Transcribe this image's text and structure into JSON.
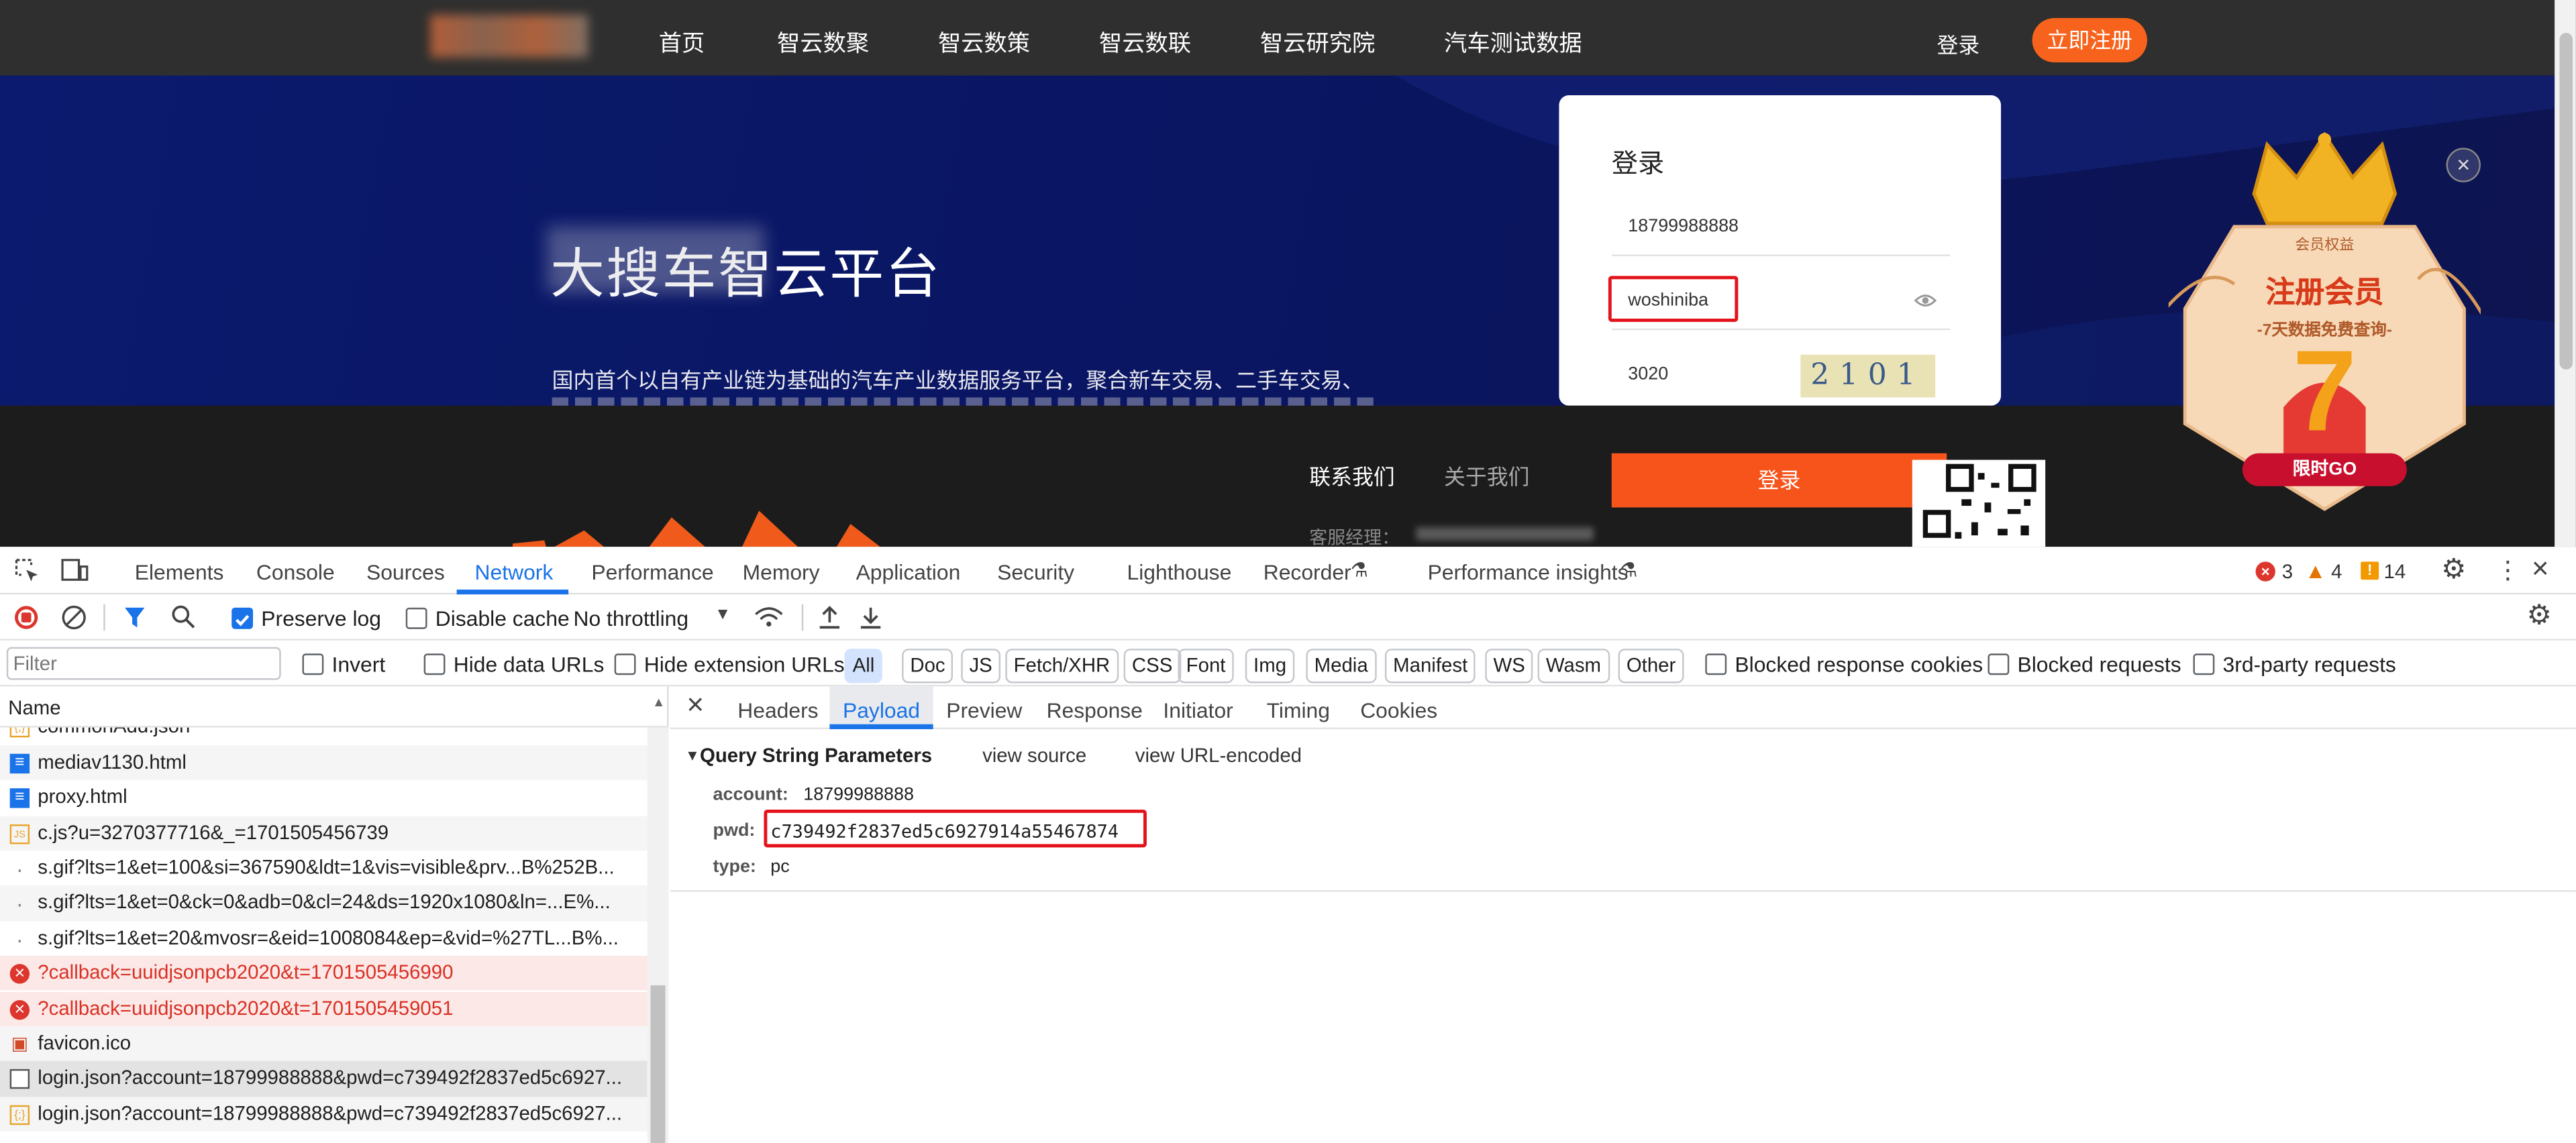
{
  "site": {
    "nav": [
      "首页",
      "智云数聚",
      "智云数策",
      "智云数联",
      "智云研究院",
      "汽车测试数据"
    ],
    "login_link": "登录",
    "register_button": "立即注册",
    "hero_title": "大搜车智云平台",
    "hero_desc": "国内首个以自有产业链为基础的汽车产业数据服务平台，聚合新车交易、二手车交易、",
    "login_panel": {
      "title": "登录",
      "account": "18799988888",
      "password": "woshiniba",
      "captcha_input": "3020",
      "captcha_text": "2101",
      "submit": "登录"
    },
    "footer": {
      "contact": "联系我们",
      "about": "关于我们",
      "manager_label": "客服经理："
    },
    "promo": {
      "badge": "会员权益",
      "title": "注册会员",
      "subtitle": "-7天数据免费查询-",
      "number": "7",
      "cta": "限时GO"
    }
  },
  "devtools": {
    "tabs": [
      "Elements",
      "Console",
      "Sources",
      "Network",
      "Performance",
      "Memory",
      "Application",
      "Security",
      "Lighthouse",
      "Recorder",
      "Performance insights"
    ],
    "active_tab": "Network",
    "counts": {
      "errors": "3",
      "warnings": "4",
      "info": "14"
    },
    "toolbar": {
      "preserve_log": "Preserve log",
      "disable_cache": "Disable cache",
      "throttling": "No throttling"
    },
    "filter": {
      "placeholder": "Filter",
      "invert": "Invert",
      "hide_data_urls": "Hide data URLs",
      "hide_extension_urls": "Hide extension URLs",
      "types": [
        "All",
        "Doc",
        "JS",
        "Fetch/XHR",
        "CSS",
        "Font",
        "Img",
        "Media",
        "Manifest",
        "WS",
        "Wasm",
        "Other"
      ],
      "blocked_response_cookies": "Blocked response cookies",
      "blocked_requests": "Blocked requests",
      "third_party": "3rd-party requests"
    },
    "name_header": "Name",
    "requests": [
      {
        "name": "commonAdd.json",
        "icon": "json-icon",
        "status": "ok"
      },
      {
        "name": "mediav1130.html",
        "icon": "document-icon",
        "status": "ok"
      },
      {
        "name": "proxy.html",
        "icon": "document-icon",
        "status": "ok"
      },
      {
        "name": "c.js?u=3270377716&_=1701505456739",
        "icon": "script-icon",
        "status": "ok"
      },
      {
        "name": "s.gif?lts=1&et=100&si=367590&ldt=1&vis=visible&prv...B%252B...",
        "icon": "dot-icon",
        "status": "ok"
      },
      {
        "name": "s.gif?lts=1&et=0&ck=0&adb=0&cl=24&ds=1920x1080&ln=...E%...",
        "icon": "dot-icon",
        "status": "ok"
      },
      {
        "name": "s.gif?lts=1&et=20&mvosr=&eid=1008084&ep=&vid=%27TL...B%...",
        "icon": "dot-icon",
        "status": "ok"
      },
      {
        "name": "?callback=uuidjsonpcb2020&t=1701505456990",
        "icon": "error-icon",
        "status": "error"
      },
      {
        "name": "?callback=uuidjsonpcb2020&t=1701505459051",
        "icon": "error-icon",
        "status": "error"
      },
      {
        "name": "favicon.ico",
        "icon": "image-icon",
        "status": "ok"
      },
      {
        "name": "login.json?account=18799988888&pwd=c739492f2837ed5c6927...",
        "icon": "checkbox-icon",
        "status": "selected"
      },
      {
        "name": "login.json?account=18799988888&pwd=c739492f2837ed5c6927...",
        "icon": "json-icon",
        "status": "ok"
      }
    ],
    "detail_tabs": [
      "Headers",
      "Payload",
      "Preview",
      "Response",
      "Initiator",
      "Timing",
      "Cookies"
    ],
    "active_detail_tab": "Payload",
    "payload": {
      "section": "Query String Parameters",
      "view_source": "view source",
      "view_url_encoded": "view URL-encoded",
      "params": [
        {
          "key": "account:",
          "value": "18799988888"
        },
        {
          "key": "pwd:",
          "value": "c739492f2837ed5c6927914a55467874"
        },
        {
          "key": "type:",
          "value": "pc"
        }
      ]
    }
  }
}
